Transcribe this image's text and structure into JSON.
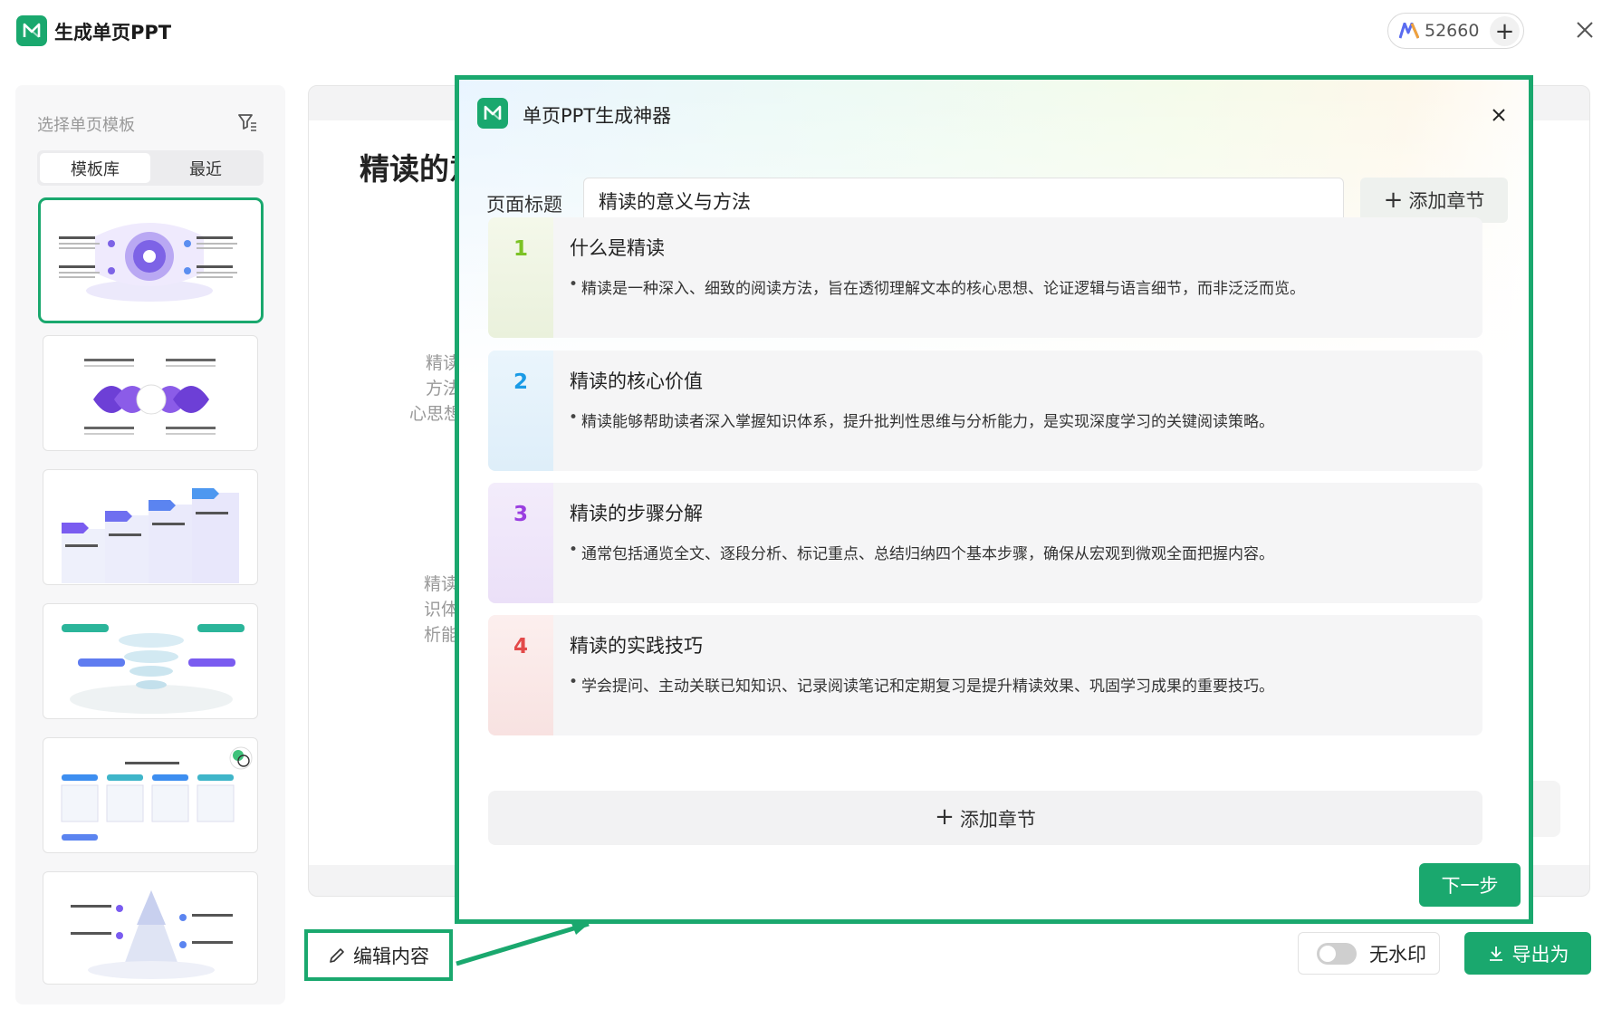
{
  "app": {
    "title": "生成单页PPT",
    "credits": "52660"
  },
  "sidebar": {
    "title": "选择单页模板",
    "tabs": [
      "模板库",
      "最近"
    ]
  },
  "preview": {
    "title_partial": "精读的意",
    "left_fragments_a": [
      "精读",
      "方法",
      "心思想"
    ],
    "left_fragments_b": [
      "精读",
      "识体",
      "析能"
    ]
  },
  "bottom": {
    "edit_label": "编辑内容",
    "watermark_label": "无水印",
    "export_label": "导出为"
  },
  "modal": {
    "title": "单页PPT生成神器",
    "page_title_label": "页面标题",
    "page_title_value": "精读的意义与方法",
    "add_chapter_label": "添加章节",
    "next_label": "下一步",
    "sections": [
      {
        "num": "1",
        "title": "什么是精读",
        "bullet": "精读是一种深入、细致的阅读方法，旨在透彻理解文本的核心思想、论证逻辑与语言细节，而非泛泛而览。",
        "color": "#7cc225"
      },
      {
        "num": "2",
        "title": "精读的核心价值",
        "bullet": "精读能够帮助读者深入掌握知识体系，提升批判性思维与分析能力，是实现深度学习的关键阅读策略。",
        "color": "#1a9be6"
      },
      {
        "num": "3",
        "title": "精读的步骤分解",
        "bullet": "通常包括通览全文、逐段分析、标记重点、总结归纳四个基本步骤，确保从宏观到微观全面把握内容。",
        "color": "#9a3ee0"
      },
      {
        "num": "4",
        "title": "精读的实践技巧",
        "bullet": "学会提问、主动关联已知知识、记录阅读笔记和定期复习是提升精读效果、巩固学习成果的重要技巧。",
        "color": "#e34a4a"
      }
    ]
  }
}
